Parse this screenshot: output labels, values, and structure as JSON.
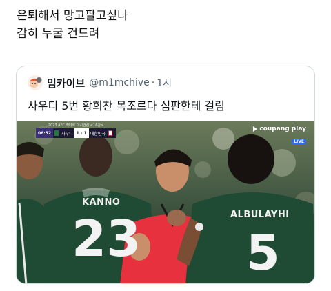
{
  "post": {
    "lines": [
      "은퇴해서 망고팔고싶나",
      "감히 누굴 건드려"
    ]
  },
  "quote": {
    "display_name": "밈카이브",
    "handle": "@m1mchive",
    "separator": "·",
    "time": "1시",
    "text": "사우디 5번 황희찬 목조르다 심판한테 걸림"
  },
  "media": {
    "scorebug": {
      "league": "2023 AFC 카타르 아시안컵 <16강>",
      "clock": "06:52",
      "home_team": "사우디",
      "score": "1 - 1",
      "away_team": "대한민국"
    },
    "broadcaster": {
      "brand": "coupang play",
      "live_badge": "LIVE"
    },
    "jerseys": [
      {
        "name": "KANNO",
        "number": "23"
      },
      {
        "name": "ALBULAYHI",
        "number": "5"
      }
    ]
  },
  "colors": {
    "saudi_green": "#1f4a33",
    "referee_red": "#e8313f",
    "card_border": "#cfd9de",
    "muted_text": "#536471"
  }
}
